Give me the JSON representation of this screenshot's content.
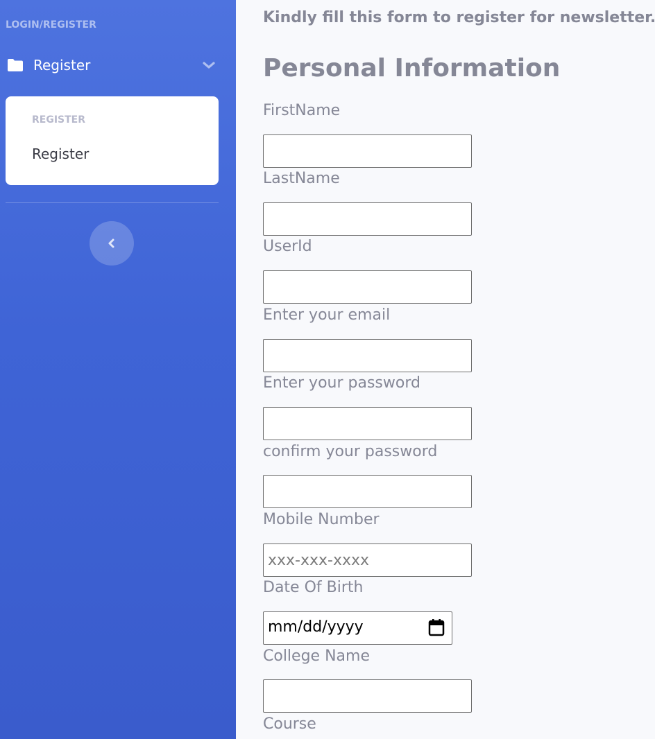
{
  "sidebar": {
    "heading": "LOGIN/REGISTER",
    "nav_item": {
      "label": "Register",
      "icon": "folder-icon",
      "toggle_icon": "chevron-down-icon"
    },
    "collapse": {
      "header": "REGISTER",
      "items": [
        "Register"
      ]
    },
    "toggle_icon": "chevron-left-icon",
    "colors": {
      "gradient_top": "#4e73df",
      "gradient_bottom": "#3a5ccc"
    }
  },
  "main": {
    "intro": "Kindly fill this form to register for newsletter.",
    "section_title": "Personal Information",
    "fields": {
      "first_name": {
        "label": "FirstName",
        "value": "",
        "placeholder": ""
      },
      "last_name": {
        "label": "LastName",
        "value": "",
        "placeholder": ""
      },
      "user_id": {
        "label": "UserId",
        "value": "",
        "placeholder": ""
      },
      "email": {
        "label": "Enter your email",
        "value": "",
        "placeholder": ""
      },
      "password": {
        "label": "Enter your password",
        "value": "",
        "placeholder": ""
      },
      "confirm_password": {
        "label": "confirm your password",
        "value": "",
        "placeholder": ""
      },
      "mobile": {
        "label": "Mobile Number",
        "value": "",
        "placeholder": "xxx-xxx-xxxx"
      },
      "dob": {
        "label": "Date Of Birth",
        "value": "mm/dd/yyyy",
        "icon": "calendar-icon"
      },
      "college": {
        "label": "College Name",
        "value": "",
        "placeholder": ""
      },
      "course": {
        "label": "Course"
      }
    },
    "colors": {
      "text": "#858796",
      "background": "#f8f9fc"
    }
  }
}
